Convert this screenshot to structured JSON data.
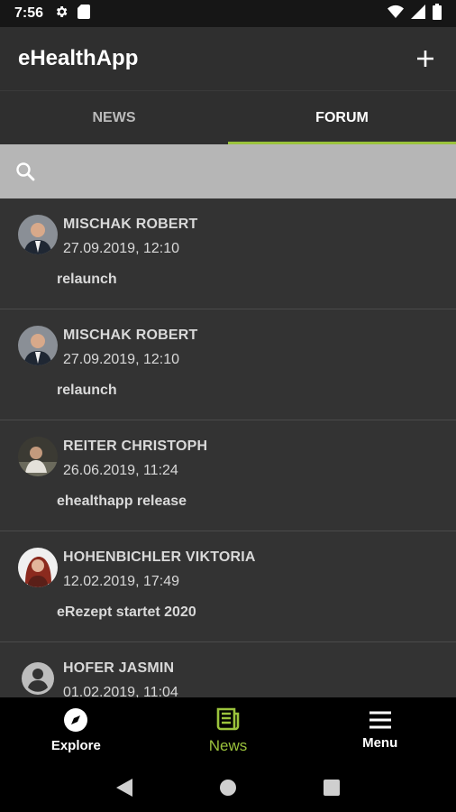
{
  "status_bar": {
    "time": "7:56",
    "left_icons": [
      "gear-icon",
      "sd-card-icon"
    ],
    "right_icons": [
      "wifi-icon",
      "signal-icon",
      "battery-icon"
    ]
  },
  "app_bar": {
    "title": "eHealthApp",
    "action_icon": "plus-icon"
  },
  "tabs": [
    {
      "label": "NEWS",
      "active": false
    },
    {
      "label": "FORUM",
      "active": true
    }
  ],
  "search": {
    "placeholder": "",
    "value": "",
    "icon": "search-icon"
  },
  "posts": [
    {
      "author": "MISCHAK ROBERT",
      "date": "27.09.2019, 12:10",
      "title": "relaunch",
      "avatar": "photo"
    },
    {
      "author": "MISCHAK ROBERT",
      "date": "27.09.2019, 12:10",
      "title": "relaunch",
      "avatar": "photo"
    },
    {
      "author": "REITER CHRISTOPH",
      "date": "26.06.2019, 11:24",
      "title": "ehealthapp release",
      "avatar": "photo"
    },
    {
      "author": "HOHENBICHLER VIKTORIA",
      "date": "12.02.2019, 17:49",
      "title": "eRezept startet 2020",
      "avatar": "photo"
    },
    {
      "author": "HOFER JASMIN",
      "date": "01.02.2019, 11:04",
      "title": "",
      "avatar": "placeholder"
    }
  ],
  "bottom_nav": [
    {
      "label": "Explore",
      "icon": "compass-icon",
      "active": false
    },
    {
      "label": "News",
      "icon": "newspaper-icon",
      "active": true
    },
    {
      "label": "Menu",
      "icon": "hamburger-icon",
      "active": false
    }
  ],
  "system_nav": [
    "back-icon",
    "home-icon",
    "recents-icon"
  ],
  "colors": {
    "accent": "#9bc33c",
    "app_bar": "#2f2f2f",
    "list_bg": "#333333",
    "search_bg": "#b6b6b6"
  }
}
